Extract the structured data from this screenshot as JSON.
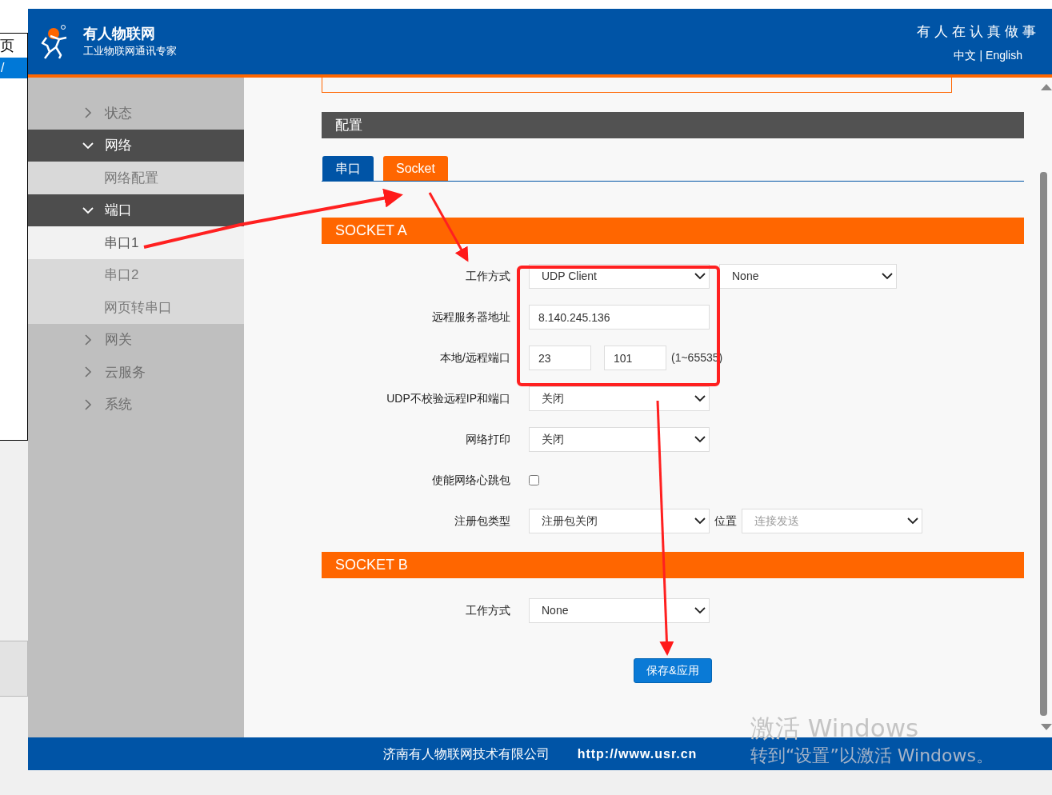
{
  "background_window": {
    "texts": [
      "页",
      "/"
    ]
  },
  "header": {
    "title": "有人物联网",
    "subtitle": "工业物联网通讯专家",
    "slogan": "有人在认真做事",
    "languages": [
      "中文",
      "English"
    ],
    "separator": "|"
  },
  "sidebar": {
    "items": [
      {
        "label": "状态",
        "expanded": false
      },
      {
        "label": "网络",
        "expanded": true,
        "children": [
          {
            "label": "网络配置",
            "selected": false
          }
        ]
      },
      {
        "label": "端口",
        "expanded": true,
        "children": [
          {
            "label": "串口1",
            "selected": true
          },
          {
            "label": "串口2",
            "selected": false
          },
          {
            "label": "网页转串口",
            "selected": false
          }
        ]
      },
      {
        "label": "网关",
        "expanded": false
      },
      {
        "label": "云服务",
        "expanded": false
      },
      {
        "label": "系统",
        "expanded": false
      }
    ]
  },
  "section_title": "配置",
  "tabs": [
    {
      "label": "串口",
      "selected": false
    },
    {
      "label": "Socket",
      "selected": true
    }
  ],
  "sockets": [
    {
      "title": "SOCKET A",
      "fields": [
        {
          "label": "工作方式",
          "controls": [
            {
              "kind": "select",
              "value": "UDP Client",
              "disabled": false
            },
            {
              "kind": "select",
              "value": "None",
              "disabled": false
            }
          ]
        },
        {
          "label": "远程服务器地址",
          "controls": [
            {
              "kind": "input",
              "value": "8.140.245.136"
            }
          ]
        },
        {
          "label": "本地/远程端口",
          "controls": [
            {
              "kind": "port",
              "value": "23"
            },
            {
              "kind": "port",
              "value": "101"
            },
            {
              "kind": "hint",
              "value": "(1~65535)"
            }
          ]
        },
        {
          "label": "UDP不校验远程IP和端口",
          "controls": [
            {
              "kind": "select",
              "value": "关闭",
              "disabled": false
            }
          ]
        },
        {
          "label": "网络打印",
          "controls": [
            {
              "kind": "select",
              "value": "关闭",
              "disabled": false
            }
          ]
        },
        {
          "label": "使能网络心跳包",
          "controls": [
            {
              "kind": "checkbox",
              "checked": false
            }
          ]
        },
        {
          "label": "注册包类型",
          "controls": [
            {
              "kind": "select",
              "value": "注册包关闭",
              "disabled": false
            },
            {
              "kind": "label",
              "value": "位置"
            },
            {
              "kind": "select",
              "value": "连接发送",
              "disabled": true
            }
          ]
        }
      ]
    },
    {
      "title": "SOCKET B",
      "fields": [
        {
          "label": "工作方式",
          "controls": [
            {
              "kind": "select",
              "value": "None",
              "disabled": false
            }
          ]
        }
      ]
    }
  ],
  "save_button": "保存&应用",
  "footer": {
    "company": "济南有人物联网技术有限公司",
    "url": "http://www.usr.cn"
  },
  "activation_notice": {
    "title": "激活 Windows",
    "message": "转到“设置”以激活 Windows。"
  }
}
